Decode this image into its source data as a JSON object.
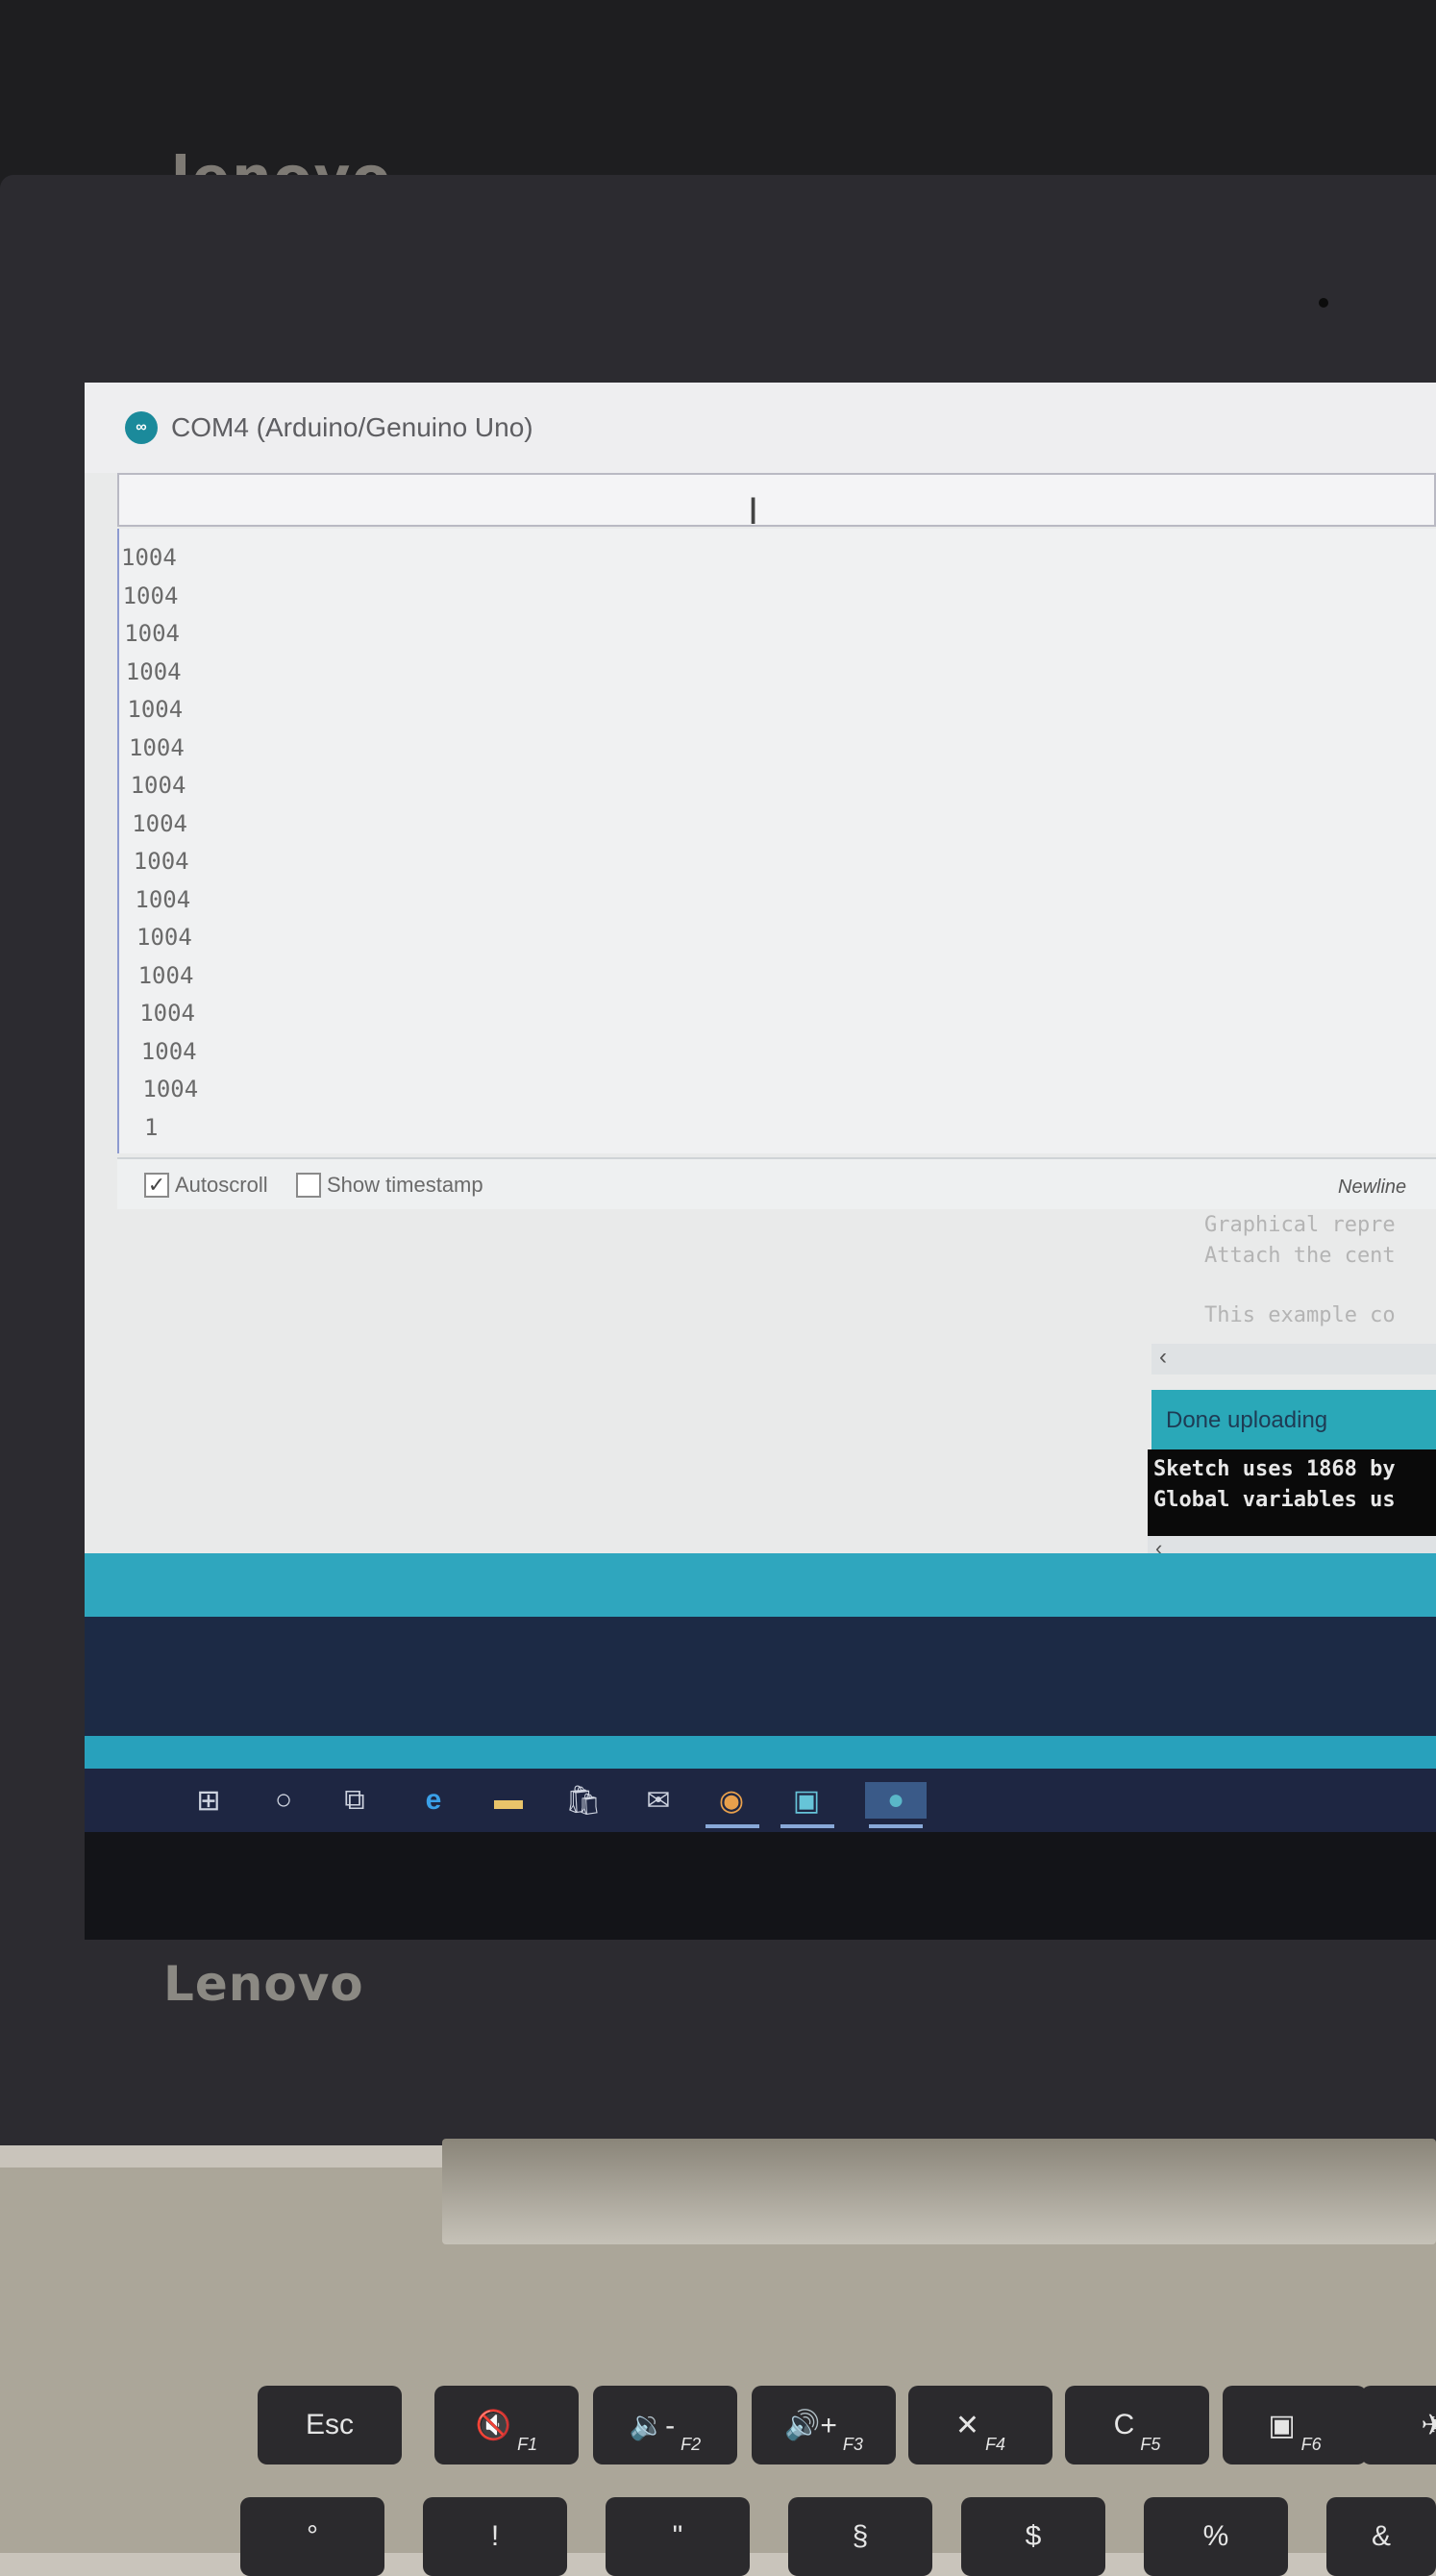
{
  "background_laptop": {
    "logo": "lenovo"
  },
  "laptop": {
    "lid_logo": "Lenovo"
  },
  "serial_monitor": {
    "title": "COM4 (Arduino/Genuino Uno)",
    "input_value": "",
    "output_lines": [
      "1004",
      "1004",
      "1004",
      "1004",
      "1004",
      "1004",
      "1004",
      "1004",
      "1004",
      "1004",
      "1004",
      "1004",
      "1004",
      "1004",
      "1004",
      "1"
    ],
    "autoscroll": {
      "label": "Autoscroll",
      "checked": true
    },
    "show_timestamp": {
      "label": "Show timestamp",
      "checked": false
    },
    "line_ending": "Newline"
  },
  "ide": {
    "editor_lines": [
      "Graphical repre",
      "Attach the cent",
      "",
      "This example co"
    ],
    "status": "Done uploading",
    "console_lines": [
      "Sketch uses 1868 by",
      "Global variables us"
    ]
  },
  "taskbar": {
    "icons": [
      "windows-start-icon",
      "cortana-icon",
      "task-view-icon",
      "edge-icon",
      "file-explorer-icon",
      "store-icon",
      "mail-icon",
      "chrome-icon",
      "app-icon",
      "arduino-icon"
    ]
  },
  "keyboard": {
    "keys": [
      {
        "label": "Esc",
        "fn": ""
      },
      {
        "label": "🔇",
        "fn": "F1"
      },
      {
        "label": "🔉-",
        "fn": "F2"
      },
      {
        "label": "🔊+",
        "fn": "F3"
      },
      {
        "label": "✕",
        "fn": "F4"
      },
      {
        "label": "C",
        "fn": "F5"
      },
      {
        "label": "▣",
        "fn": "F6"
      },
      {
        "label": "✈",
        "fn": ""
      }
    ],
    "number_row": [
      "°",
      "!",
      "\"",
      "§",
      "$",
      "%",
      "&"
    ]
  }
}
